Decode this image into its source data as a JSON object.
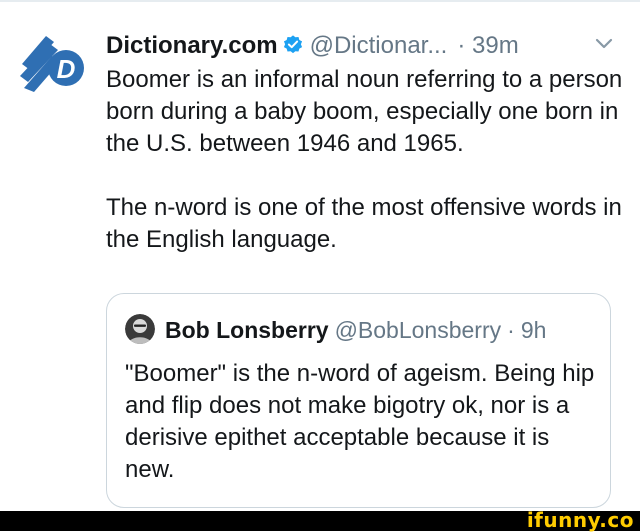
{
  "tweet": {
    "display_name": "Dictionary.com",
    "handle": "@Dictionar...",
    "separator": "·",
    "time": "39m",
    "paragraphs": [
      "Boomer is an informal noun referring to a person born during a baby boom, especially one born in the U.S. between 1946 and 1965.",
      "The n-word is one of the most offensive words in the English language."
    ],
    "avatar_icon": "dictionary-logo-icon",
    "verified_icon": "verified-badge-icon",
    "menu_icon": "chevron-down-icon"
  },
  "quoted_tweet": {
    "display_name": "Bob Lonsberry",
    "handle": "@BobLonsberry",
    "separator": "·",
    "time": "9h",
    "text": "\"Boomer\" is the n-word of ageism. Being hip and flip does not make bigotry ok, nor is a derisive epithet acceptable because it is new."
  },
  "watermark": "ifunny.co",
  "colors": {
    "brand_blue": "#2f6fb3",
    "verified_blue": "#1da1f2",
    "secondary_text": "#657786",
    "border": "#ccd6dd",
    "watermark_yellow": "#ffcc00"
  }
}
